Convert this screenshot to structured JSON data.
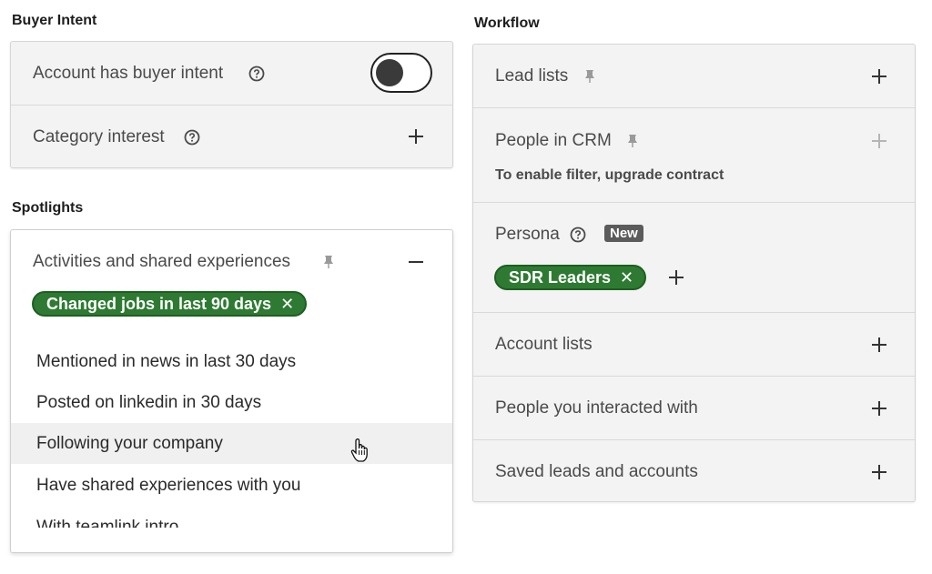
{
  "buyer_intent": {
    "title": "Buyer Intent",
    "rows": [
      {
        "label": "Account has buyer intent",
        "control": "toggle",
        "toggle_on": false
      },
      {
        "label": "Category interest",
        "control": "plus-icon"
      }
    ]
  },
  "spotlights": {
    "title": "Spotlights",
    "header_label": "Activities and shared experiences",
    "selected_chip": "Changed jobs in last 90 days",
    "options": [
      "Mentioned in news in last 30 days",
      "Posted on linkedin in 30 days",
      "Following your company",
      "Have shared experiences with you",
      "With teamlink intro"
    ],
    "hovered_option_index": 2
  },
  "workflow": {
    "title": "Workflow",
    "lead_lists": "Lead lists",
    "people_in_crm": "People in CRM",
    "people_in_crm_note": "To enable filter, upgrade contract",
    "persona": "Persona",
    "persona_badge": "New",
    "persona_chip": "SDR Leaders",
    "account_lists": "Account lists",
    "people_interacted": "People you interacted with",
    "saved_leads": "Saved leads and accounts"
  },
  "colors": {
    "chip_green": "#2e7a32",
    "panel_bg": "#f3f3f3",
    "badge_gray": "#5b5b5b"
  },
  "icons": [
    "help-icon",
    "pin-icon",
    "plus-icon",
    "minus-icon",
    "close-icon",
    "hand-cursor-icon"
  ]
}
